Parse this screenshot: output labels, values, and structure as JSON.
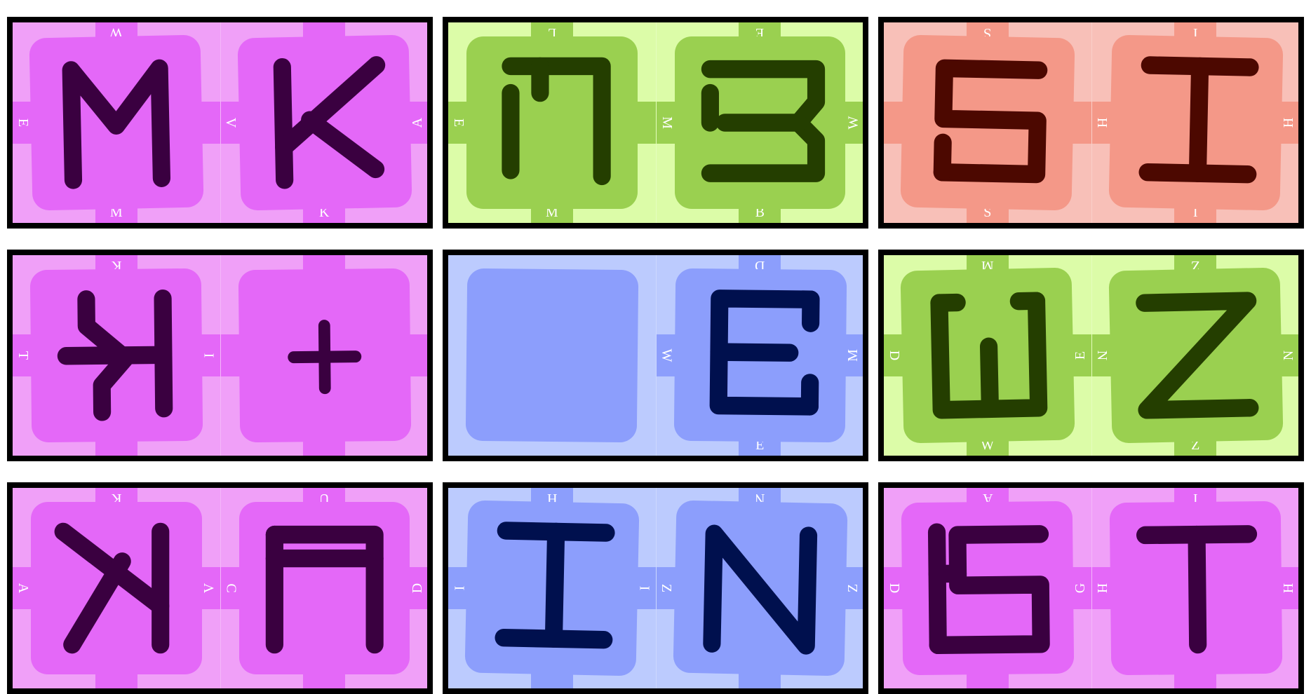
{
  "themes": {
    "pink": {
      "bg": "#f0a0f8",
      "tile": "#e468f8",
      "ink": "#3a0040"
    },
    "green": {
      "bg": "#dcfca8",
      "tile": "#9ad050",
      "ink": "#243e00"
    },
    "red": {
      "bg": "#f8c0b8",
      "tile": "#f49888",
      "ink": "#4c0800"
    },
    "blue": {
      "bg": "#bccbfe",
      "tile": "#8c9efc",
      "ink": "#00104e"
    }
  },
  "cards": [
    {
      "theme": "pink",
      "tiles": [
        {
          "glyph": "M",
          "labels": {
            "top": "W",
            "bottom": "M",
            "left": "E",
            "right": ""
          }
        },
        {
          "glyph": "K",
          "labels": {
            "top": "",
            "bottom": "K",
            "left": "V",
            "right": "A"
          }
        }
      ]
    },
    {
      "theme": "green",
      "tiles": [
        {
          "glyph": "L",
          "labels": {
            "top": "L",
            "bottom": "M",
            "left": "E",
            "right": ""
          }
        },
        {
          "glyph": "B",
          "labels": {
            "top": "E",
            "bottom": "B",
            "left": "M",
            "right": "W"
          }
        }
      ]
    },
    {
      "theme": "red",
      "tiles": [
        {
          "glyph": "S",
          "labels": {
            "top": "S",
            "bottom": "S",
            "left": "",
            "right": ""
          }
        },
        {
          "glyph": "H",
          "labels": {
            "top": "I",
            "bottom": "I",
            "left": "H",
            "right": "H"
          }
        }
      ]
    },
    {
      "theme": "pink",
      "tiles": [
        {
          "glyph": "KT",
          "labels": {
            "top": "K",
            "bottom": "",
            "left": "T",
            "right": "I"
          }
        },
        {
          "glyph": "+",
          "labels": {
            "top": "",
            "bottom": "",
            "left": "",
            "right": ""
          }
        }
      ]
    },
    {
      "theme": "blue",
      "tiles": [
        {
          "glyph": "",
          "labels": {
            "top": "",
            "bottom": "",
            "left": "",
            "right": ""
          }
        },
        {
          "glyph": "E",
          "labels": {
            "top": "D",
            "bottom": "E",
            "left": "W",
            "right": "M"
          }
        }
      ]
    },
    {
      "theme": "green",
      "tiles": [
        {
          "glyph": "W",
          "labels": {
            "top": "M",
            "bottom": "W",
            "left": "D",
            "right": "E"
          }
        },
        {
          "glyph": "Z",
          "labels": {
            "top": "Z",
            "bottom": "Z",
            "left": "N",
            "right": "N"
          }
        }
      ]
    },
    {
      "theme": "pink",
      "tiles": [
        {
          "glyph": "AK",
          "labels": {
            "top": "K",
            "bottom": "",
            "left": "A",
            "right": "V"
          }
        },
        {
          "glyph": "U",
          "labels": {
            "top": "U",
            "bottom": "",
            "left": "C",
            "right": "D"
          }
        }
      ]
    },
    {
      "theme": "blue",
      "tiles": [
        {
          "glyph": "H",
          "labels": {
            "top": "H",
            "bottom": "",
            "left": "I",
            "right": "I"
          }
        },
        {
          "glyph": "N",
          "labels": {
            "top": "N",
            "bottom": "",
            "left": "Z",
            "right": "Z"
          }
        }
      ]
    },
    {
      "theme": "pink",
      "tiles": [
        {
          "glyph": "SA",
          "labels": {
            "top": "A",
            "bottom": "",
            "left": "D",
            "right": "G"
          }
        },
        {
          "glyph": "T",
          "labels": {
            "top": "I",
            "bottom": "",
            "left": "H",
            "right": "H"
          }
        }
      ]
    }
  ]
}
